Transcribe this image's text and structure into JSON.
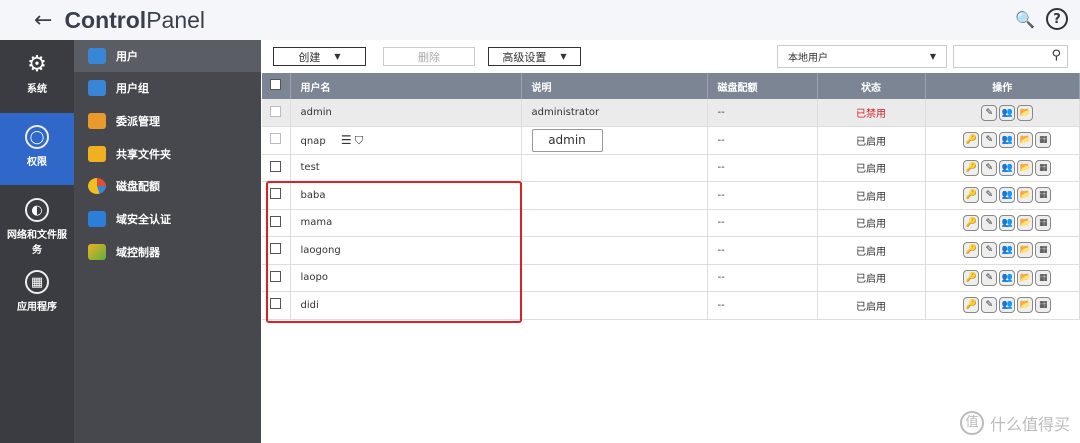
{
  "header": {
    "back": "←",
    "title_bold": "Control",
    "title_rest": "Panel"
  },
  "nav": [
    {
      "label": "系统",
      "icon": "⚙"
    },
    {
      "label": "权限",
      "icon": "👤"
    },
    {
      "label": "网络和文件服务",
      "icon": "🌐"
    },
    {
      "label": "应用程序",
      "icon": "▦"
    }
  ],
  "submenu": [
    "用户",
    "用户组",
    "委派管理",
    "共享文件夹",
    "磁盘配额",
    "域安全认证",
    "域控制器"
  ],
  "submenu_colors": [
    "#3a86d6",
    "#3a86d6",
    "#e89a2a",
    "#f0b020",
    "#e05030",
    "#2a80d8",
    "#5cb040"
  ],
  "toolbar": {
    "create": "创建",
    "delete": "删除",
    "advanced": "高级设置",
    "filter": "本地用户",
    "search_placeholder": ""
  },
  "columns": [
    "用户名",
    "说明",
    "磁盘配额",
    "状态",
    "操作"
  ],
  "rows": [
    {
      "name": "admin",
      "desc": "administrator",
      "quota": "--",
      "status": "已禁用"
    },
    {
      "name": "qnap",
      "desc": "admin",
      "quota": "--",
      "status": "已启用"
    },
    {
      "name": "test",
      "desc": "",
      "quota": "--",
      "status": "已启用"
    },
    {
      "name": "baba",
      "desc": "",
      "quota": "--",
      "status": "已启用"
    },
    {
      "name": "mama",
      "desc": "",
      "quota": "--",
      "status": "已启用"
    },
    {
      "name": "laogong",
      "desc": "",
      "quota": "--",
      "status": "已启用"
    },
    {
      "name": "laopo",
      "desc": "",
      "quota": "--",
      "status": "已启用"
    },
    {
      "name": "didi",
      "desc": "",
      "quota": "--",
      "status": "已启用"
    }
  ],
  "watermark": {
    "logo": "值",
    "text": "什么值得买"
  }
}
